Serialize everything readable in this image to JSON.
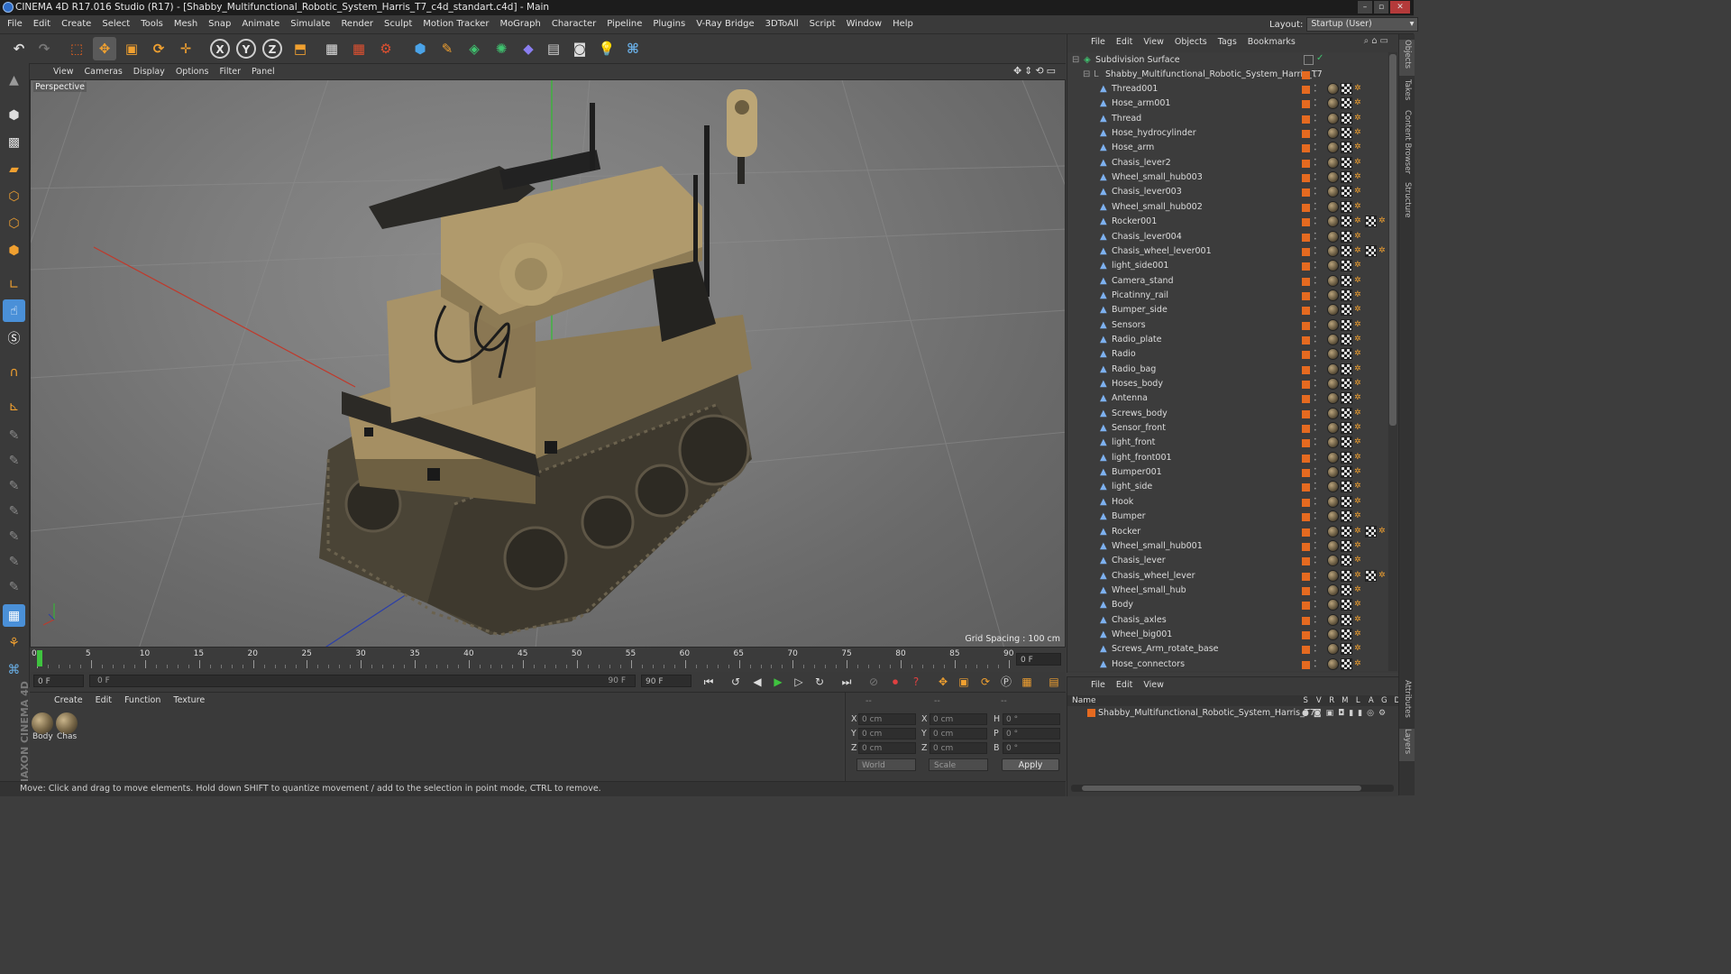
{
  "window": {
    "title": "CINEMA 4D R17.016 Studio (R17) - [Shabby_Multifunctional_Robotic_System_Harris_T7_c4d_standart.c4d] - Main"
  },
  "menu": [
    "File",
    "Edit",
    "Create",
    "Select",
    "Tools",
    "Mesh",
    "Snap",
    "Animate",
    "Simulate",
    "Render",
    "Sculpt",
    "Motion Tracker",
    "MoGraph",
    "Character",
    "Pipeline",
    "Plugins",
    "V-Ray Bridge",
    "3DToAll",
    "Script",
    "Window",
    "Help"
  ],
  "layout": {
    "label": "Layout:",
    "value": "Startup (User)"
  },
  "viewport": {
    "menu": [
      "View",
      "Cameras",
      "Display",
      "Options",
      "Filter",
      "Panel"
    ],
    "camera_label": "Perspective",
    "grid_spacing": "Grid Spacing : 100 cm"
  },
  "timeline": {
    "ticks": [
      "0",
      "5",
      "10",
      "15",
      "20",
      "25",
      "30",
      "35",
      "40",
      "45",
      "50",
      "55",
      "60",
      "65",
      "70",
      "75",
      "80",
      "85",
      "90"
    ],
    "current_frame": "0 F",
    "start_field": "0 F",
    "range_start": "0 F",
    "range_end": "90 F",
    "end_field": "90 F"
  },
  "material_manager": {
    "menu": [
      "Create",
      "Edit",
      "Function",
      "Texture"
    ],
    "materials": [
      "Body",
      "Chas"
    ]
  },
  "coordinates": {
    "headers": [
      "--",
      "--",
      "--"
    ],
    "rows": [
      {
        "a_label": "X",
        "a_val": "0 cm",
        "b_label": "X",
        "b_val": "0 cm",
        "c_label": "H",
        "c_val": "0 °"
      },
      {
        "a_label": "Y",
        "a_val": "0 cm",
        "b_label": "Y",
        "b_val": "0 cm",
        "c_label": "P",
        "c_val": "0 °"
      },
      {
        "a_label": "Z",
        "a_val": "0 cm",
        "b_label": "Z",
        "b_val": "0 cm",
        "c_label": "B",
        "c_val": "0 °"
      }
    ],
    "mode_world": "World",
    "mode_scale": "Scale",
    "apply": "Apply"
  },
  "brand_text": "MAXON CINEMA 4D",
  "status_text": "Move: Click and drag to move elements. Hold down SHIFT to quantize movement / add to the selection in point mode, CTRL to remove.",
  "object_manager": {
    "menu": [
      "File",
      "Edit",
      "View",
      "Objects",
      "Tags",
      "Bookmarks"
    ],
    "root": "Subdivision Surface",
    "group": "Shabby_Multifunctional_Robotic_System_Harris_T7",
    "objects": [
      "Thread001",
      "Hose_arm001",
      "Thread",
      "Hose_hydrocylinder",
      "Hose_arm",
      "Chasis_lever2",
      "Wheel_small_hub003",
      "Chasis_lever003",
      "Wheel_small_hub002",
      "Rocker001",
      "Chasis_lever004",
      "Chasis_wheel_lever001",
      "light_side001",
      "Camera_stand",
      "Picatinny_rail",
      "Bumper_side",
      "Sensors",
      "Radio_plate",
      "Radio",
      "Radio_bag",
      "Hoses_body",
      "Antenna",
      "Screws_body",
      "Sensor_front",
      "light_front",
      "light_front001",
      "Bumper001",
      "light_side",
      "Hook",
      "Bumper",
      "Rocker",
      "Wheel_small_hub001",
      "Chasis_lever",
      "Chasis_wheel_lever",
      "Wheel_small_hub",
      "Body",
      "Chasis_axles",
      "Wheel_big001",
      "Screws_Arm_rotate_base",
      "Hose_connectors"
    ]
  },
  "layer_manager": {
    "menu": [
      "File",
      "Edit",
      "View"
    ],
    "name_header": "Name",
    "columns": [
      "S",
      "V",
      "R",
      "M",
      "L",
      "A",
      "G",
      "D"
    ],
    "layer": "Shabby_Multifunctional_Robotic_System_Harris_T7"
  },
  "right_tabs": [
    "Objects",
    "Takes",
    "Content Browser",
    "Structure",
    "Attributes",
    "Layers"
  ],
  "colors": {
    "layer_orange": "#e56a20",
    "object_blue": "#7db1f0",
    "axis_y": "#2fbf2f",
    "axis_x": "#c0392b",
    "axis_z": "#2b3fa8",
    "playhead": "#3fc33f"
  }
}
